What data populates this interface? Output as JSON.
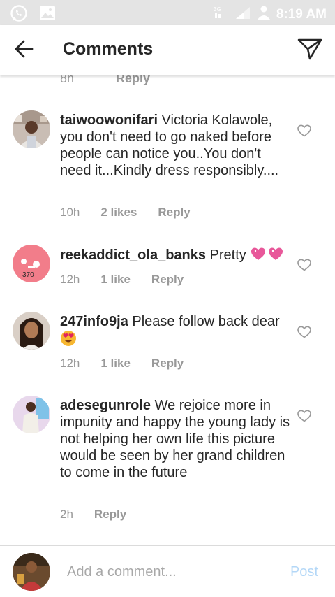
{
  "status_bar": {
    "time": "8:19 AM",
    "left_icons": [
      "whatsapp-icon",
      "image-icon"
    ],
    "right_icons": [
      "network-3g-icon",
      "signal-icon",
      "user-icon"
    ]
  },
  "header": {
    "title": "Comments",
    "back_icon": "arrow-left-icon",
    "send_icon": "paper-plane-icon"
  },
  "partial_comment": {
    "time": "8h",
    "reply_label": "Reply"
  },
  "comments": [
    {
      "username": "taiwoowonifari",
      "text": " Victoria Kolawole, you don't need to go naked before people can notice you..You don't need it...Kindly dress responsibly....",
      "time": "10h",
      "likes": "2 likes",
      "reply_label": "Reply"
    },
    {
      "username": "reekaddict_ola_banks",
      "text": " Pretty ",
      "emoji": "two-hearts-emoji",
      "time": "12h",
      "likes": "1 like",
      "reply_label": "Reply"
    },
    {
      "username": "247info9ja",
      "text": " Please follow back dear ",
      "emoji": "heart-eyes-emoji",
      "time": "12h",
      "likes": "1 like",
      "reply_label": "Reply"
    },
    {
      "username": "adesegunrole",
      "text": " We rejoice more in impunity and happy the young lady is not helping her own life this picture would be seen by her grand children to come in the future",
      "time": "2h",
      "likes": "",
      "reply_label": "Reply"
    }
  ],
  "composer": {
    "placeholder": "Add a comment...",
    "post_label": "Post"
  },
  "colors": {
    "status_bar_bg": "#e4e4e4",
    "meta_text": "#999999",
    "post_disabled": "#b3d7f7",
    "text": "#262626"
  }
}
